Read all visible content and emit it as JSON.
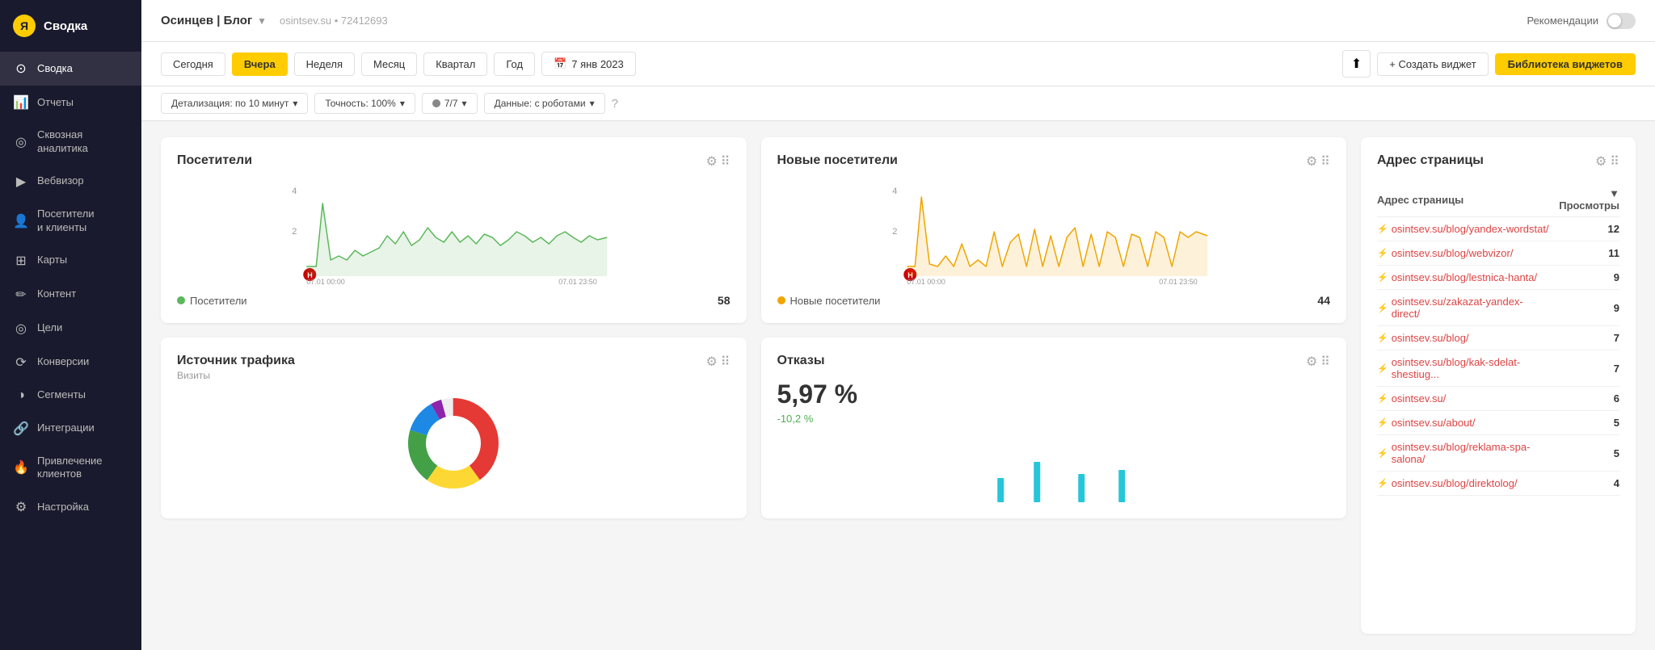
{
  "sidebar": {
    "logo_label": "Сводка",
    "logo_icon": "Я",
    "items": [
      {
        "id": "svodka",
        "label": "Сводка",
        "icon": "⊙",
        "active": true
      },
      {
        "id": "otchety",
        "label": "Отчеты",
        "icon": "📊"
      },
      {
        "id": "skvoznaya",
        "label": "Сквозная\nаналитика",
        "icon": "◎"
      },
      {
        "id": "vebvizor",
        "label": "Вебвизор",
        "icon": "▶"
      },
      {
        "id": "posetiteli",
        "label": "Посетители\nи клиенты",
        "icon": "👤"
      },
      {
        "id": "karty",
        "label": "Карты",
        "icon": "⊞"
      },
      {
        "id": "kontent",
        "label": "Контент",
        "icon": "✏"
      },
      {
        "id": "tseli",
        "label": "Цели",
        "icon": "◎"
      },
      {
        "id": "konversii",
        "label": "Конверсии",
        "icon": "⟳"
      },
      {
        "id": "segmenty",
        "label": "Сегменты",
        "icon": "◑"
      },
      {
        "id": "integracii",
        "label": "Интеграции",
        "icon": "🔗"
      },
      {
        "id": "privlechenie",
        "label": "Привлечение\nклиентов",
        "icon": "🔥"
      },
      {
        "id": "nastroyka",
        "label": "Настройка",
        "icon": "⚙"
      }
    ]
  },
  "header": {
    "site_name": "Осинцев | Блог",
    "site_subtitle": "osintsev.su • 72412693",
    "rec_label": "Рекомендации"
  },
  "toolbar": {
    "date_buttons": [
      {
        "id": "today",
        "label": "Сегодня",
        "active": false
      },
      {
        "id": "yesterday",
        "label": "Вчера",
        "active": true
      },
      {
        "id": "week",
        "label": "Неделя",
        "active": false
      },
      {
        "id": "month",
        "label": "Месяц",
        "active": false
      },
      {
        "id": "quarter",
        "label": "Квартал",
        "active": false
      },
      {
        "id": "year",
        "label": "Год",
        "active": false
      }
    ],
    "date_range": "7 янв 2023",
    "create_widget_label": "+ Создать виджет",
    "library_label": "Библиотека виджетов"
  },
  "filters": {
    "detail_label": "Детализация: по 10 минут",
    "accuracy_label": "Точность: 100%",
    "sessions_label": "7/7",
    "data_label": "Данные: с роботами"
  },
  "visitors_card": {
    "title": "Посетители",
    "legend_label": "Посетители",
    "legend_value": "58",
    "chart_color": "#5cb85c",
    "y_labels": [
      "4",
      "2"
    ],
    "x_labels": [
      "07.01 00:00",
      "07.01 23:50"
    ]
  },
  "new_visitors_card": {
    "title": "Новые посетители",
    "legend_label": "Новые посетители",
    "legend_value": "44",
    "chart_color": "#f0a500",
    "y_labels": [
      "4",
      "2"
    ],
    "x_labels": [
      "07.01 00:00",
      "07.01 23:50"
    ]
  },
  "address_card": {
    "title": "Адрес страницы",
    "col_address": "Адрес страницы",
    "col_views": "Просмотры",
    "rows": [
      {
        "url": "osintsev.su/blog/yandex-wordstat/",
        "views": 12
      },
      {
        "url": "osintsev.su/blog/webvizor/",
        "views": 11
      },
      {
        "url": "osintsev.su/blog/lestnica-hanta/",
        "views": 9
      },
      {
        "url": "osintsev.su/zakazat-yandex-direct/",
        "views": 9
      },
      {
        "url": "osintsev.su/blog/",
        "views": 7
      },
      {
        "url": "osintsev.su/blog/kak-sdelat-shestiug...",
        "views": 7
      },
      {
        "url": "osintsev.su/",
        "views": 6
      },
      {
        "url": "osintsev.su/about/",
        "views": 5
      },
      {
        "url": "osintsev.su/blog/reklama-spa-salona/",
        "views": 5
      },
      {
        "url": "osintsev.su/blog/direktolog/",
        "views": 4
      }
    ]
  },
  "traffic_card": {
    "title": "Источник трафика",
    "subtitle": "Визиты"
  },
  "bounce_card": {
    "title": "Отказы",
    "value": "5,97 %",
    "change": "-10,2 %",
    "chart_color": "#26c6da"
  }
}
